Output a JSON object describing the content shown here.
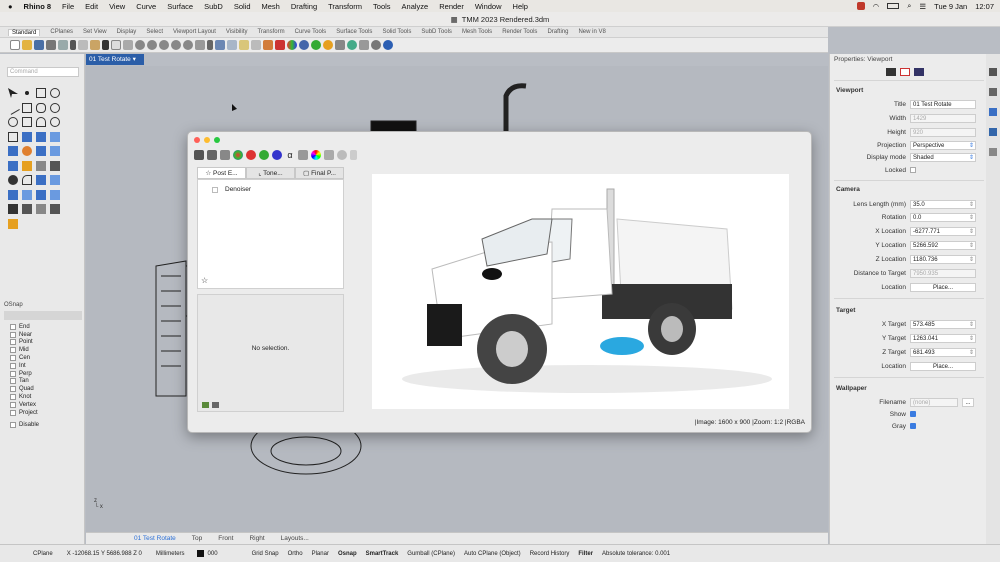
{
  "menubar": {
    "app_name": "Rhino 8",
    "items": [
      "File",
      "Edit",
      "View",
      "Curve",
      "Surface",
      "SubD",
      "Solid",
      "Mesh",
      "Drafting",
      "Transform",
      "Tools",
      "Analyze",
      "Render",
      "Window",
      "Help"
    ],
    "date": "Tue 9 Jan",
    "time": "12:07"
  },
  "window": {
    "title": "TMM 2023 Rendered.3dm"
  },
  "toolbar_tabs": [
    "Standard",
    "CPlanes",
    "Set View",
    "Display",
    "Select",
    "Viewport Layout",
    "Visibility",
    "Transform",
    "Curve Tools",
    "Surface Tools",
    "Solid Tools",
    "SubD Tools",
    "Mesh Tools",
    "Render Tools",
    "Drafting",
    "New in V8"
  ],
  "command": {
    "placeholder": "Command"
  },
  "osnap": {
    "title": "OSnap",
    "options": [
      "End",
      "Near",
      "Point",
      "Mid",
      "Cen",
      "Int",
      "Perp",
      "Tan",
      "Quad",
      "Knot",
      "Vertex",
      "Project"
    ],
    "disable_label": "Disable"
  },
  "viewport": {
    "active_tab": "01 Test Rotate"
  },
  "bottom_tabs": [
    "01 Test Rotate",
    "Top",
    "Front",
    "Right",
    "Layouts..."
  ],
  "statusbar": {
    "cplane": "CPlane",
    "coords": "X -12068.15 Y 5686.988 Z 0",
    "units": "Millimeters",
    "layer": "000",
    "items": [
      "Grid Snap",
      "Ortho",
      "Planar",
      "Osnap",
      "SmartTrack",
      "Gumball (CPlane)",
      "Auto CPlane (Object)",
      "Record History",
      "Filter"
    ],
    "tolerance": "Absolute tolerance: 0.001"
  },
  "properties": {
    "title": "Properties: Viewport",
    "viewport_section": "Viewport",
    "camera_section": "Camera",
    "target_section": "Target",
    "wallpaper_section": "Wallpaper",
    "labels": {
      "title": "Title",
      "width": "Width",
      "height": "Height",
      "projection": "Projection",
      "display_mode": "Display mode",
      "locked": "Locked",
      "lens_length": "Lens Length (mm)",
      "rotation": "Rotation",
      "x_location": "X Location",
      "y_location": "Y Location",
      "z_location": "Z Location",
      "distance": "Distance to Target",
      "location": "Location",
      "x_target": "X Target",
      "y_target": "Y Target",
      "z_target": "Z Target",
      "target_location": "Location",
      "filename": "Filename",
      "show": "Show",
      "gray": "Gray"
    },
    "values": {
      "title": "01 Test Rotate",
      "width": "1429",
      "height": "920",
      "projection": "Perspective",
      "display_mode": "Shaded",
      "lens_length": "35.0",
      "rotation": "0.0",
      "x_location": "-6277.771",
      "y_location": "5266.592",
      "z_location": "1180.736",
      "distance": "7950.935",
      "place_button": "Place...",
      "x_target": "573.485",
      "y_target": "1263.041",
      "z_target": "681.493",
      "filename": "(none)",
      "browse": "..."
    }
  },
  "render_window": {
    "tabs": [
      "Post E...",
      "Tone...",
      "Final P..."
    ],
    "post_effects": [
      "Denoiser"
    ],
    "no_selection": "No selection.",
    "image_info": "Image: 1600 x 900",
    "zoom": "Zoom: 1:2",
    "mode": "RGBA"
  }
}
